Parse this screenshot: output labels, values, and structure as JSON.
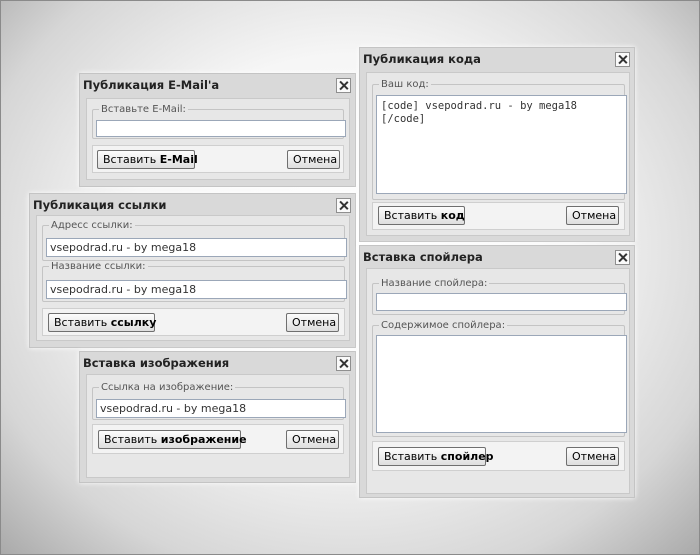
{
  "email_dialog": {
    "title": "Публикация E-Mail'a",
    "field_label": "Вставьте E-Mail:",
    "field_value": "",
    "submit_prefix": "Вставить",
    "submit_bold": "E-Mail",
    "cancel_label": "Отмена"
  },
  "link_dialog": {
    "title": "Публикация ссылки",
    "address_label": "Адресс ссылки:",
    "address_value": "vsepodrad.ru - by mega18",
    "name_label": "Название ссылки:",
    "name_value": "vsepodrad.ru - by mega18",
    "submit_prefix": "Вставить",
    "submit_bold": "ссылку",
    "cancel_label": "Отмена"
  },
  "image_dialog": {
    "title": "Вставка изображения",
    "field_label": "Ссылка на изображение:",
    "field_value": "vsepodrad.ru - by mega18",
    "submit_prefix": "Вставить",
    "submit_bold": "изображение",
    "cancel_label": "Отмена"
  },
  "code_dialog": {
    "title": "Публикация кода",
    "field_label": "Ваш код:",
    "field_value": "[code] vsepodrad.ru - by mega18 [/code]",
    "submit_prefix": "Вставить",
    "submit_bold": "код",
    "cancel_label": "Отмена"
  },
  "spoiler_dialog": {
    "title": "Вставка спойлера",
    "name_label": "Название спойлера:",
    "name_value": "",
    "content_label": "Содержимое спойлера:",
    "content_value": "",
    "submit_prefix": "Вставить",
    "submit_bold": "спойлер",
    "cancel_label": "Отмена"
  }
}
